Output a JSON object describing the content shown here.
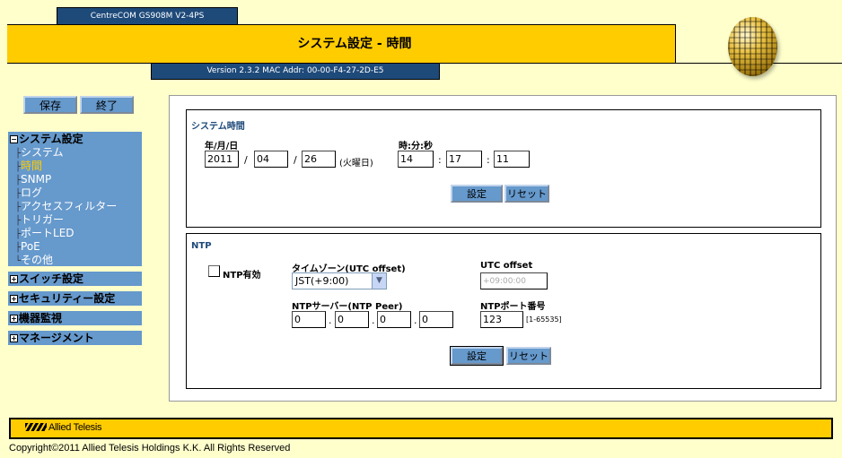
{
  "header": {
    "model": "CentreCOM GS908M V2-4PS",
    "title": "システム設定 - 時間",
    "version": "Version 2.3.2 MAC Addr: 00-00-F4-27-2D-E5"
  },
  "toolbar": {
    "save_label": "保存",
    "exit_label": "終了"
  },
  "sidebar": {
    "groups": [
      {
        "label": "システム設定",
        "expanded_symbol": "−",
        "items": [
          {
            "label": "システム",
            "branch": "├"
          },
          {
            "label": "時間",
            "branch": "├"
          },
          {
            "label": "SNMP",
            "branch": "├"
          },
          {
            "label": "ログ",
            "branch": "├"
          },
          {
            "label": "アクセスフィルター",
            "branch": "├"
          },
          {
            "label": "トリガー",
            "branch": "├"
          },
          {
            "label": "ポートLED",
            "branch": "├"
          },
          {
            "label": "PoE",
            "branch": "├"
          },
          {
            "label": "その他",
            "branch": "└"
          }
        ]
      },
      {
        "label": "スイッチ設定",
        "collapsed_symbol": "+"
      },
      {
        "label": "セキュリティー設定",
        "collapsed_symbol": "+"
      },
      {
        "label": "機器監視",
        "collapsed_symbol": "+"
      },
      {
        "label": "マネージメント",
        "collapsed_symbol": "+"
      }
    ]
  },
  "system_time": {
    "title": "システム時間",
    "date_label": "年/月/日",
    "year": "2011",
    "month": "04",
    "day": "26",
    "date_sep": "/",
    "weekday": "(火曜日)",
    "time_label": "時:分:秒",
    "hour": "14",
    "minute": "17",
    "second": "11",
    "time_sep": ":",
    "set_label": "設定",
    "reset_label": "リセット"
  },
  "ntp": {
    "title": "NTP",
    "enable_label": "NTP有効",
    "enabled": false,
    "timezone_label": "タイムゾーン(UTC offset)",
    "timezone_value": "JST(+9:00)",
    "utc_offset_label": "UTC offset",
    "utc_offset_value": "+09:00:00",
    "peer_label": "NTPサーバー(NTP Peer)",
    "peer": [
      "0",
      "0",
      "0",
      "0"
    ],
    "peer_sep": ".",
    "port_label": "NTPポート番号",
    "port_value": "123",
    "port_range": "[1-65535]",
    "set_label": "設定",
    "reset_label": "リセット"
  },
  "footer": {
    "logo": "Allied Telesis",
    "copyright": "Copyright©2011 Allied Telesis Holdings K.K. All Rights Reserved"
  },
  "colors": {
    "background": "#ffffcc",
    "title_bar": "#ffcc00",
    "header_tab": "#1e4a7a",
    "nav": "#6699cc",
    "active_nav": "#ffcc00",
    "section_title": "#1e4a7a"
  }
}
